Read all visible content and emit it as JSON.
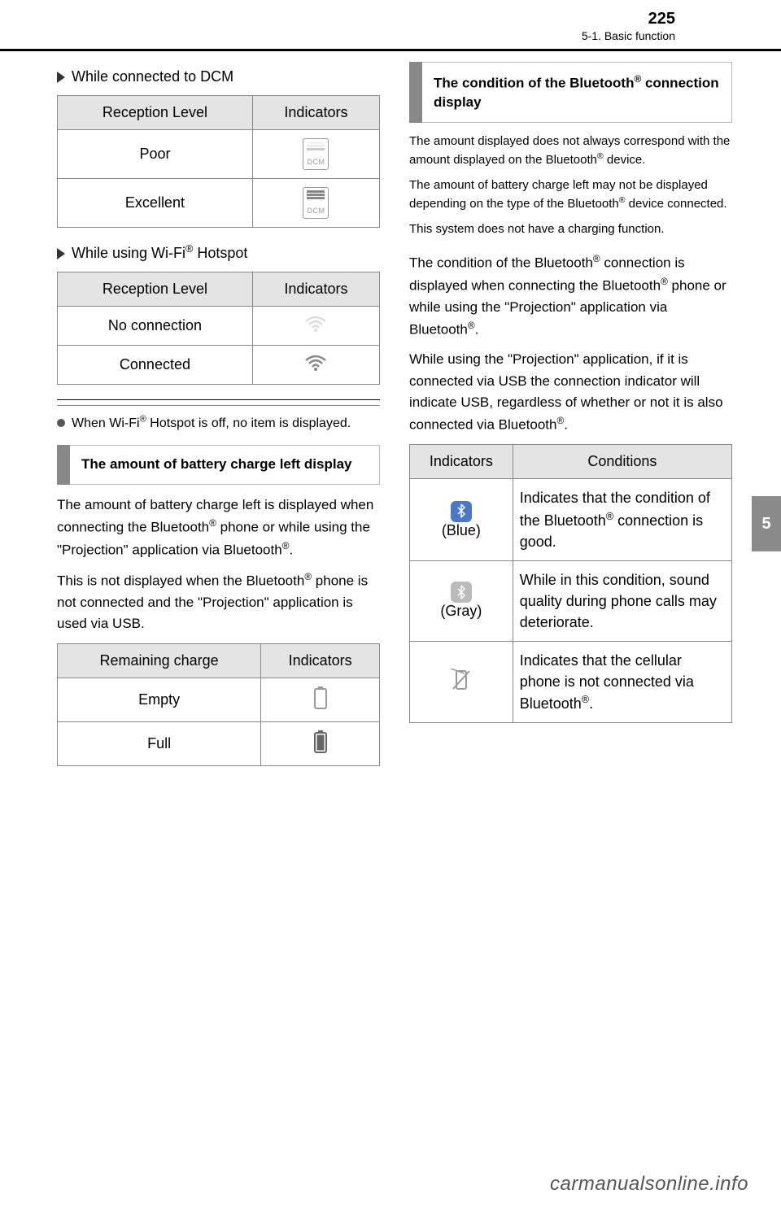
{
  "header": {
    "page_num": "225",
    "section": "5-1. Basic function"
  },
  "side_tab": "5",
  "left": {
    "sub1": "While connected to DCM",
    "tbl1": {
      "h1": "Reception Level",
      "h2": "Indicators",
      "r1": "Poor",
      "r2": "Excellent",
      "lbl": "DCM"
    },
    "sub2": "While using Wi-Fi® Hotspot",
    "tbl2": {
      "h1": "Reception Level",
      "h2": "Indicators",
      "r1": "No connection",
      "r2": "Connected"
    },
    "note": "When Wi-Fi® Hotspot is off, no item is displayed.",
    "box_title": "The amount of battery charge left display",
    "para1": "The amount of battery charge left is displayed when connecting the Bluetooth® phone or while using the \"Projection\" application via Bluetooth®.",
    "para2": "This is not displayed when the Bluetooth® phone is not connected and the \"Projection\" application is used via USB.",
    "tbl3": {
      "h1": "Remaining charge",
      "h2": "Indicators",
      "r1": "Empty",
      "r2": "Full"
    }
  },
  "right": {
    "box_title": "The condition of the Bluetooth® connection display",
    "para1": "The condition of the Bluetooth® connection is displayed when connecting the Bluetooth® phone or while using the \"Projection\" application via Bluetooth®.",
    "para2": "While using the \"Projection\" application, if it is connected via USB the connection indicator will indicate USB, regardless of whether or not it is also connected via Bluetooth®.",
    "tbl": {
      "h1": "Indicators",
      "h2": "Conditions",
      "blue_lbl": "(Blue)",
      "blue_txt": "Indicates that the condition of the Bluetooth® connection is good.",
      "gray_lbl": "(Gray)",
      "gray_txt": "While in this condition, sound quality during phone calls may deteriorate.",
      "off_txt": "Indicates that the cellular phone is not connected via Bluetooth®."
    },
    "small1": "The amount displayed does not always correspond with the amount displayed on the Bluetooth® device.",
    "small2": "The amount of battery charge left may not be displayed depending on the type of the Bluetooth® device connected.",
    "small3": "This system does not have a charging function."
  },
  "footer": "carmanualsonline.info"
}
